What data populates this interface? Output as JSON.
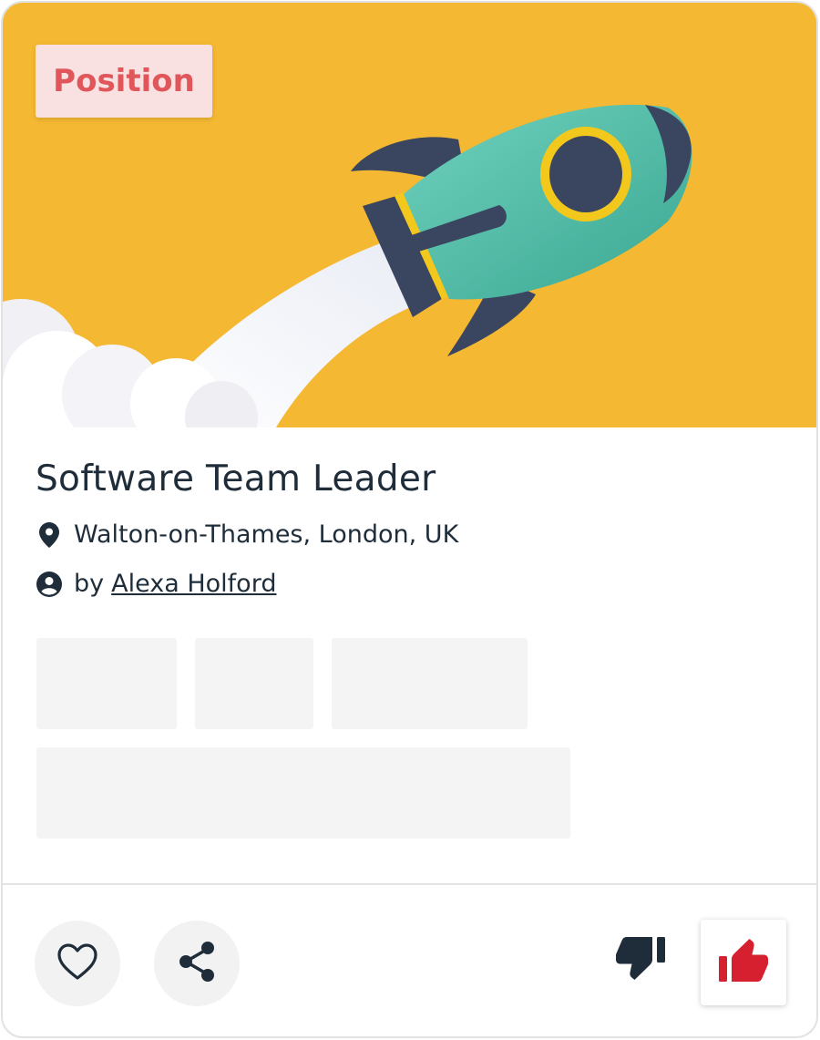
{
  "card": {
    "tag_label": "Position",
    "title": "Software Team Leader",
    "location": "Walton-on-Thames, London, UK",
    "author_prefix": "by",
    "author_name": "Alexa Holford"
  },
  "icons": {
    "location": "map-pin-icon",
    "author": "user-circle-icon",
    "like": "heart-outline-icon",
    "share": "share-icon",
    "downvote": "thumbs-down-icon",
    "upvote": "thumbs-up-icon"
  },
  "colors": {
    "hero_background": "#f4b832",
    "tag_background": "#f9e1e2",
    "tag_text": "#e0565a",
    "text": "#1f2d3a",
    "upvote_active": "#d6202f",
    "rocket_body": "#4cbfa6",
    "rocket_dark": "#3a4560"
  }
}
